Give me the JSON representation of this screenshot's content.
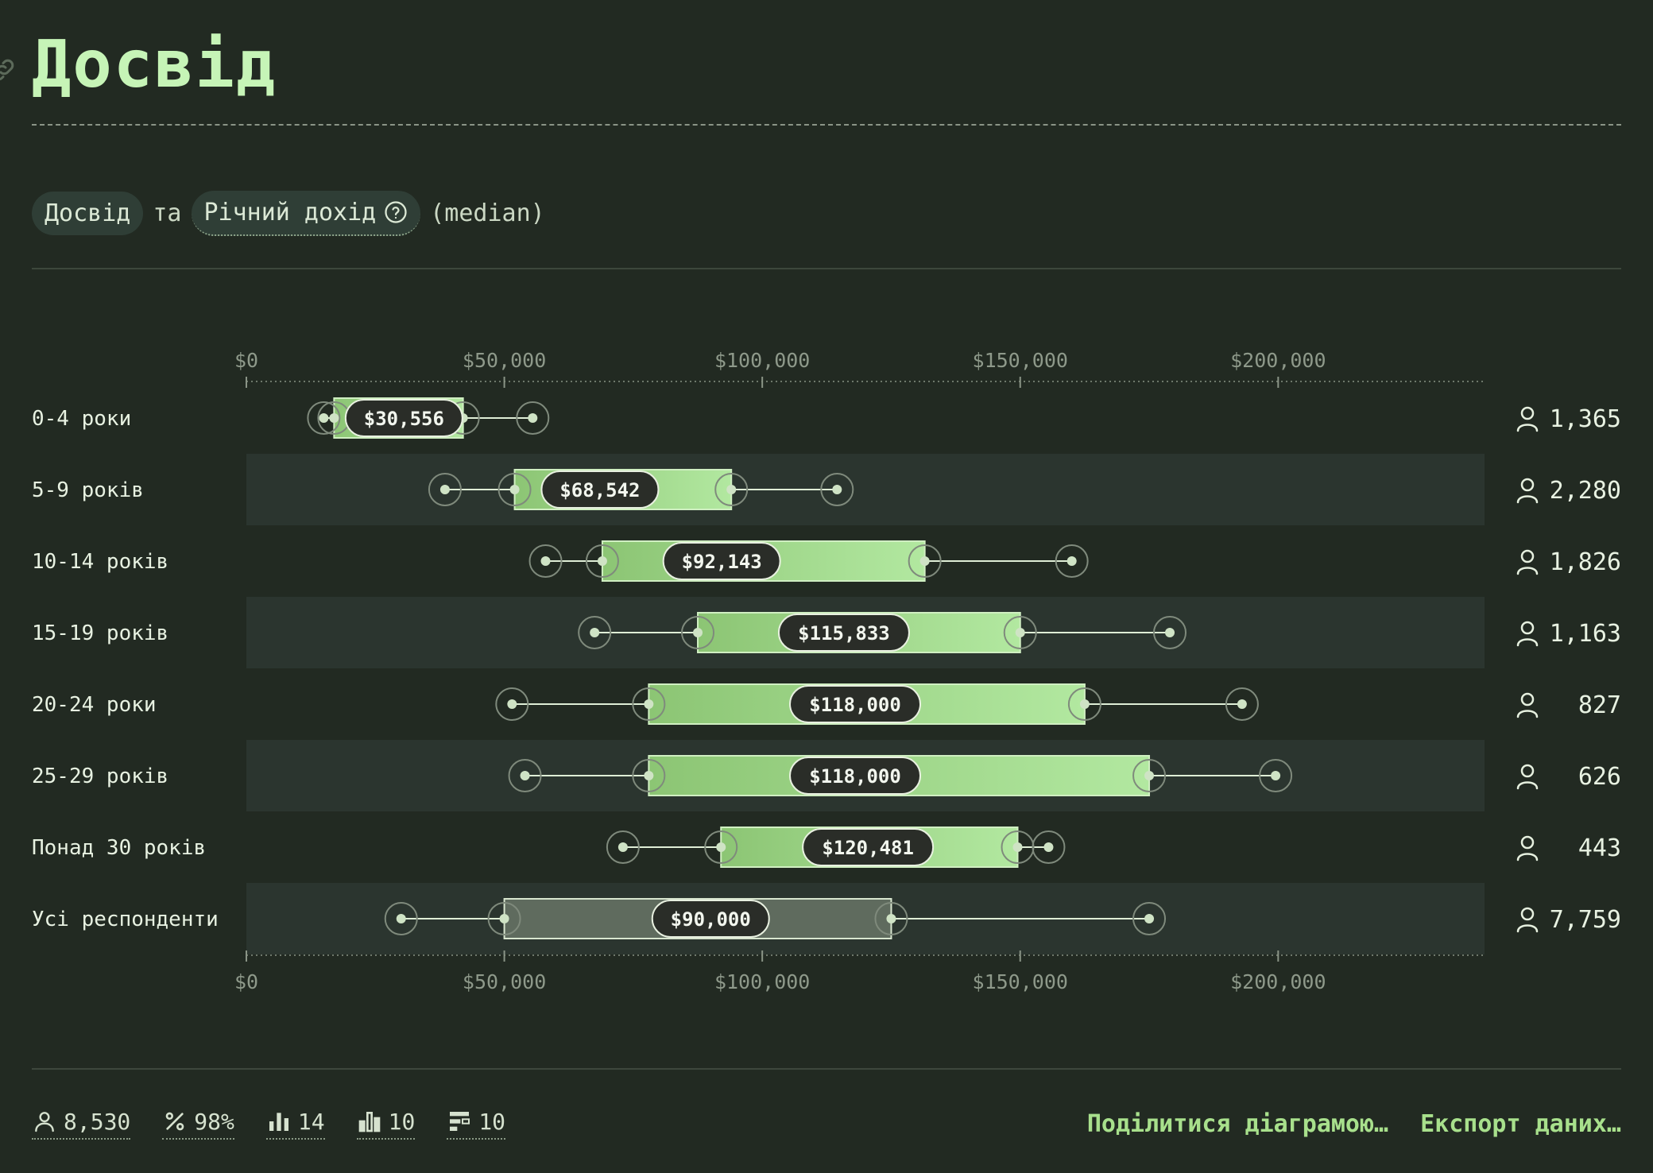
{
  "header": {
    "title": "Досвід"
  },
  "subtitle": {
    "pill1": "Досвід",
    "connector": "та",
    "pill2": "Річний дохід",
    "suffix": "(median)"
  },
  "chart_data": {
    "type": "boxplot",
    "orientation": "horizontal",
    "x_ticks": [
      0,
      50000,
      100000,
      150000,
      200000
    ],
    "x_tick_labels": [
      "$0",
      "$50,000",
      "$100,000",
      "$150,000",
      "$200,000"
    ],
    "xlim": [
      0,
      240000
    ],
    "rows": [
      {
        "label": "0-4 роки",
        "p10": 15000,
        "p25": 17000,
        "median": 30556,
        "median_label": "$30,556",
        "p75": 42000,
        "p90": 55500,
        "count": "1,365",
        "highlight": false
      },
      {
        "label": "5-9 років",
        "p10": 38500,
        "p25": 52000,
        "median": 68542,
        "median_label": "$68,542",
        "p75": 94000,
        "p90": 114500,
        "count": "2,280",
        "highlight": false
      },
      {
        "label": "10-14 років",
        "p10": 58000,
        "p25": 69000,
        "median": 92143,
        "median_label": "$92,143",
        "p75": 131500,
        "p90": 160000,
        "count": "1,826",
        "highlight": false
      },
      {
        "label": "15-19 років",
        "p10": 67500,
        "p25": 87500,
        "median": 115833,
        "median_label": "$115,833",
        "p75": 150000,
        "p90": 179000,
        "count": "1,163",
        "highlight": false
      },
      {
        "label": "20-24 роки",
        "p10": 51500,
        "p25": 78000,
        "median": 118000,
        "median_label": "$118,000",
        "p75": 162500,
        "p90": 193000,
        "count": "827",
        "highlight": false
      },
      {
        "label": "25-29 років",
        "p10": 54000,
        "p25": 78000,
        "median": 118000,
        "median_label": "$118,000",
        "p75": 175000,
        "p90": 199500,
        "count": "626",
        "highlight": false
      },
      {
        "label": "Понад 30 років",
        "p10": 73000,
        "p25": 92000,
        "median": 120481,
        "median_label": "$120,481",
        "p75": 149500,
        "p90": 155500,
        "count": "443",
        "highlight": false
      },
      {
        "label": "Усі респонденти",
        "p10": 30000,
        "p25": 50000,
        "median": 90000,
        "median_label": "$90,000",
        "p75": 125000,
        "p90": 175000,
        "count": "7,759",
        "highlight": true
      }
    ]
  },
  "footer": {
    "respondents": "8,530",
    "percent": "98%",
    "stat3": "14",
    "stat4": "10",
    "stat5": "10",
    "share_label": "Поділитися діаграмою…",
    "export_label": "Експорт даних…"
  },
  "colors": {
    "background": "#222a22",
    "accent": "#a8e08c",
    "box_start": "#8cc574",
    "box_end": "#b2e8a0",
    "row_alt": "#2b352f"
  }
}
